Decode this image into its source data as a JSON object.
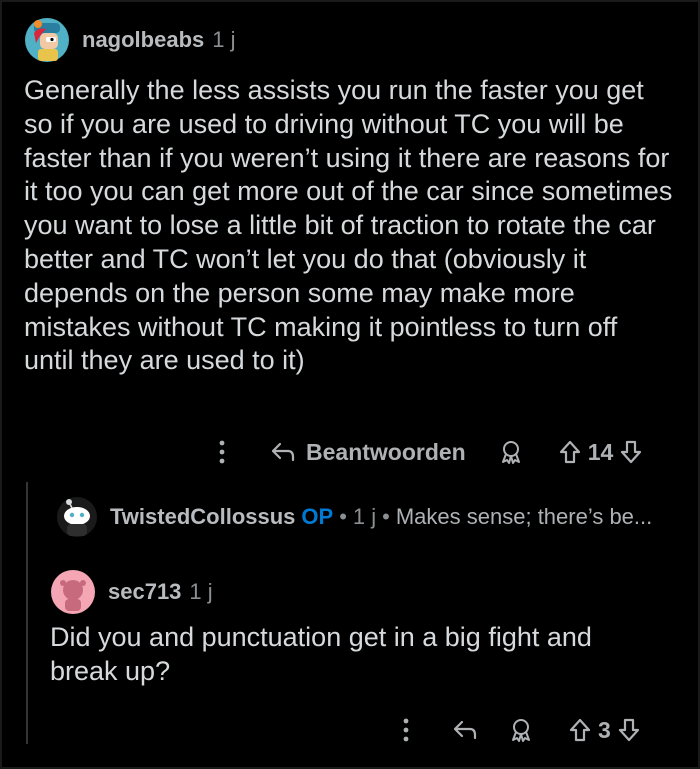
{
  "comment1": {
    "username": "nagolbeabs",
    "time": "1 j",
    "body": "Generally the less assists you run the faster you get so if you are used to driving without TC you will be faster than if you weren’t using it there are reasons for it too you can get more out of the car since sometimes you want to lose a little bit of traction to rotate the car better and TC won’t let you do that (obviously it depends on the person some may make more mistakes without TC making it pointless to turn off until they are used to it)",
    "reply_label": "Beantwoorden",
    "votes": "14"
  },
  "collapsed_reply": {
    "username": "TwistedCollossus",
    "op_badge": "OP",
    "sep1": "•",
    "time": "1 j",
    "sep2": "•",
    "preview": "Makes sense; there’s be..."
  },
  "comment2": {
    "username": "sec713",
    "time": "1 j",
    "body": "Did you and punctuation get in a big fight and break up?",
    "votes": "3"
  },
  "colors": {
    "background": "#000000",
    "text": "#d7dadc",
    "muted": "#8b8f92",
    "op_blue": "#0079d3",
    "thread_line": "#343536"
  },
  "icons": [
    "more-icon",
    "reply-arrow-icon",
    "award-icon",
    "upvote-icon",
    "downvote-icon"
  ]
}
